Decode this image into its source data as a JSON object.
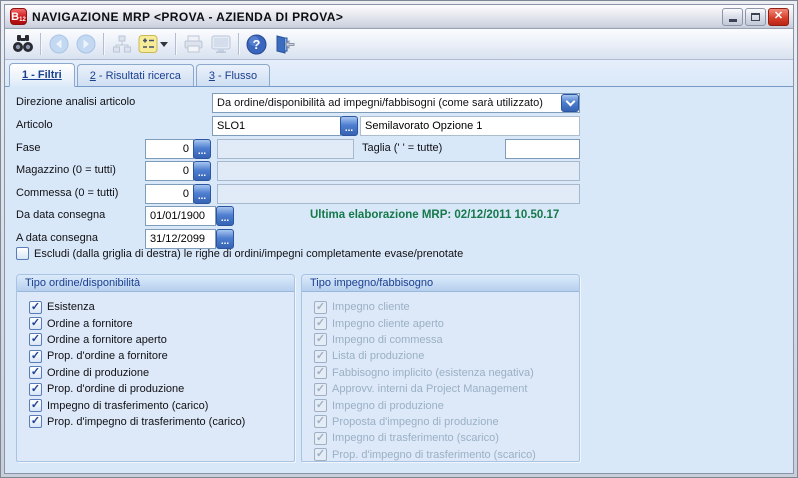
{
  "window": {
    "title": "NAVIGAZIONE MRP <PROVA - AZIENDA DI PROVA>",
    "app_icon": "b-red-logo-icon",
    "controls": {
      "minimize": "minimize",
      "maximize": "maximize",
      "close": "close"
    }
  },
  "toolbar": {
    "buttons": [
      {
        "icon": "binoculars-search-icon",
        "enabled": true
      },
      {
        "icon": "back-icon",
        "enabled": false
      },
      {
        "icon": "forward-icon",
        "enabled": false
      },
      {
        "icon": "hierarchy-icon",
        "enabled": false
      },
      {
        "icon": "expand-options-icon",
        "enabled": true
      },
      {
        "icon": "dropdown-arrow-icon",
        "enabled": true
      },
      {
        "icon": "print-icon",
        "enabled": false
      },
      {
        "icon": "monitor-preview-icon",
        "enabled": false
      },
      {
        "icon": "help-icon",
        "enabled": true
      },
      {
        "icon": "exit-door-icon",
        "enabled": true
      }
    ]
  },
  "tabs": [
    {
      "num": "1",
      "rest": " - Filtri",
      "active": true
    },
    {
      "num": "2",
      "rest": " - Risultati ricerca",
      "active": false
    },
    {
      "num": "3",
      "rest": " - Flusso",
      "active": false
    }
  ],
  "form": {
    "direzione": {
      "label": "Direzione analisi articolo",
      "value": "Da ordine/disponibilità ad impegni/fabbisogni (come sarà utilizzato)"
    },
    "articolo": {
      "label": "Articolo",
      "code": "SLO1",
      "description": "Semilavorato Opzione 1"
    },
    "fase": {
      "label": "Fase",
      "value": "0",
      "extra": ""
    },
    "taglia": {
      "label": "Taglia (' ' = tutte)",
      "value": ""
    },
    "magazzino": {
      "label": "Magazzino (0 = tutti)",
      "value": "0",
      "extra": ""
    },
    "commessa": {
      "label": "Commessa (0 = tutti)",
      "value": "0",
      "extra": ""
    },
    "da_data": {
      "label": "Da data consegna",
      "value": "01/01/1900"
    },
    "a_data": {
      "label": "A data consegna",
      "value": "31/12/2099"
    },
    "mrp_status": "Ultima elaborazione MRP: 02/12/2011 10.50.17",
    "escludi": {
      "label": "Escludi (dalla griglia di destra) le righe di ordini/impegni completamente evase/prenotate",
      "checked": false
    }
  },
  "groups": {
    "left": {
      "title": "Tipo ordine/disponibilità",
      "enabled": true,
      "items": [
        "Esistenza",
        "Ordine a fornitore",
        "Ordine a fornitore aperto",
        "Prop. d'ordine a fornitore",
        "Ordine di produzione",
        "Prop. d'ordine di produzione",
        "Impegno di trasferimento (carico)",
        "Prop. d'impegno di trasferimento (carico)"
      ],
      "checked": [
        true,
        true,
        true,
        true,
        true,
        true,
        true,
        true
      ]
    },
    "right": {
      "title": "Tipo impegno/fabbisogno",
      "enabled": false,
      "items": [
        "Impegno cliente",
        "Impegno cliente aperto",
        "Impegno di commessa",
        "Lista di produzione",
        "Fabbisogno implicito (esistenza negativa)",
        "Approvv. interni da Project Management",
        "Impegno di produzione",
        "Proposta d'impegno di produzione",
        "Impegno di trasferimento (scarico)",
        "Prop. d'impegno di trasferimento (scarico)"
      ],
      "checked": [
        true,
        true,
        true,
        true,
        true,
        true,
        true,
        true,
        true,
        true
      ]
    }
  },
  "colors": {
    "content_bg": "#d9e8f8",
    "accent_blue_button": "#3663b4",
    "field_border": "#7f9db9",
    "tab_text": "#1b3f8f",
    "status_green": "#15794b",
    "close_red": "#d9402b",
    "disabled_text": "#9ab0c6"
  }
}
